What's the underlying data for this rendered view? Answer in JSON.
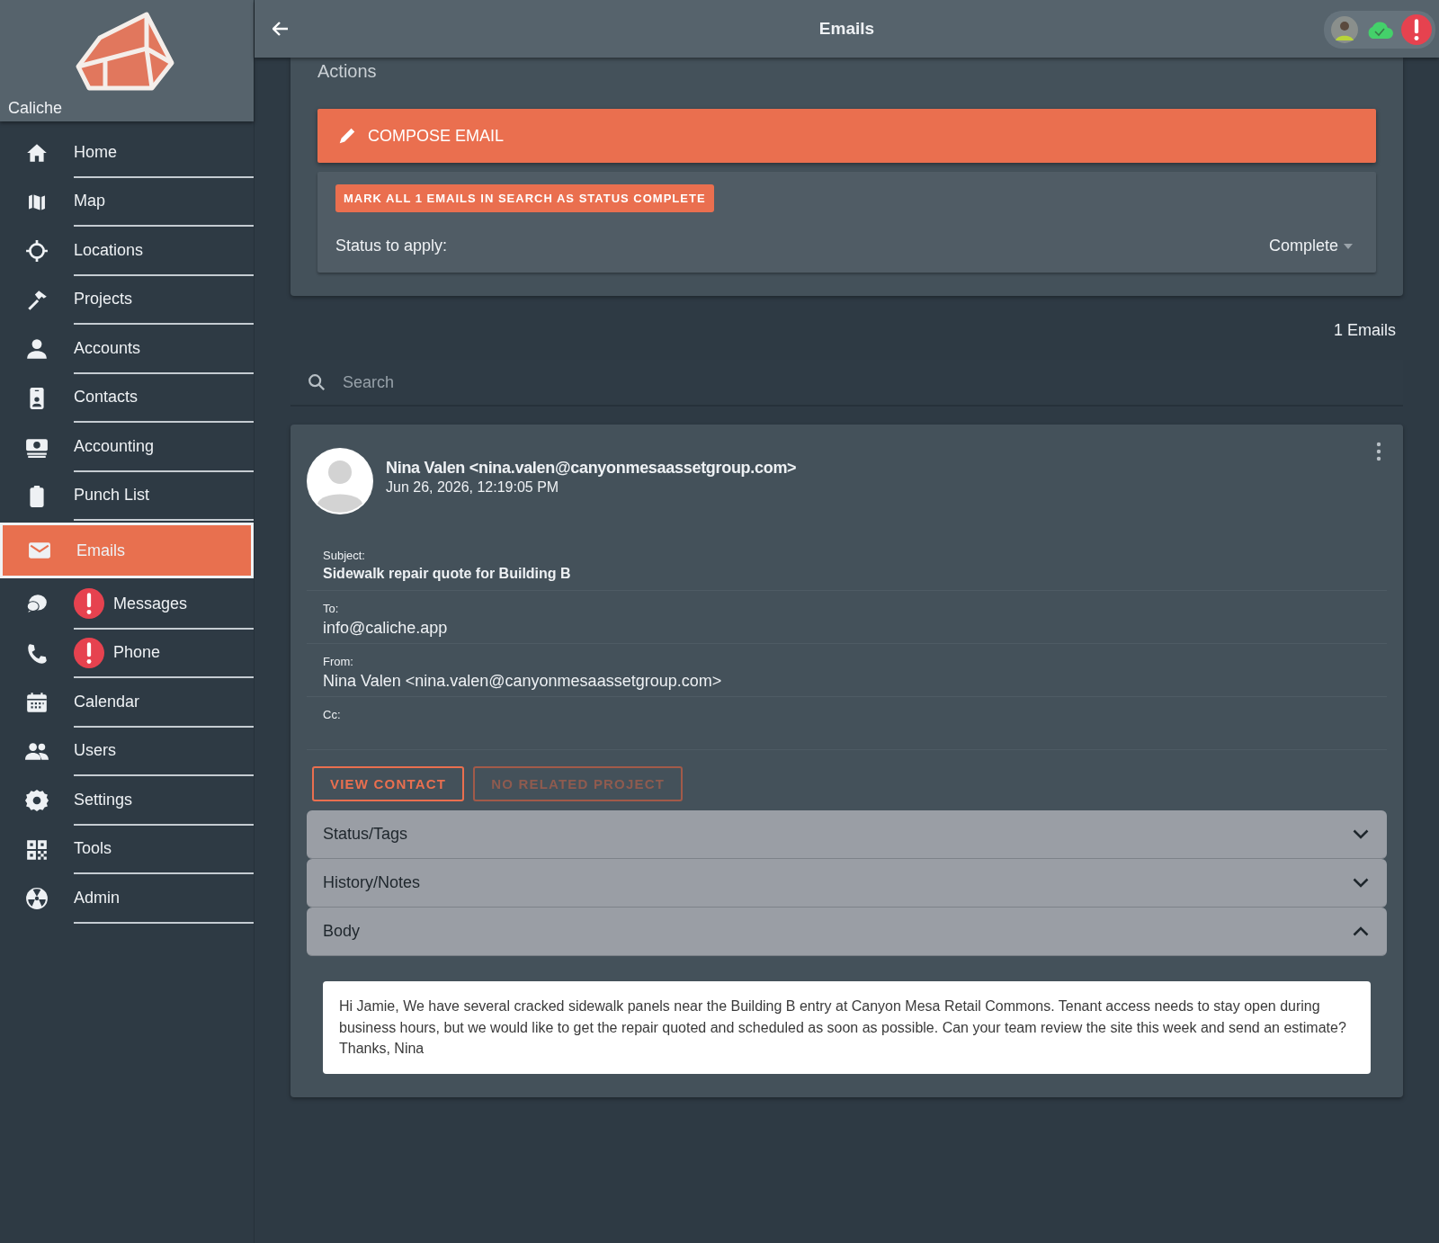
{
  "app": {
    "name": "Caliche"
  },
  "sidebar": {
    "items": [
      {
        "label": "Home",
        "kind": "home",
        "selected": false,
        "alert": false
      },
      {
        "label": "Map",
        "kind": "map",
        "selected": false,
        "alert": false
      },
      {
        "label": "Locations",
        "kind": "crosshair",
        "selected": false,
        "alert": false
      },
      {
        "label": "Projects",
        "kind": "hammer",
        "selected": false,
        "alert": false
      },
      {
        "label": "Accounts",
        "kind": "person",
        "selected": false,
        "alert": false
      },
      {
        "label": "Contacts",
        "kind": "badge",
        "selected": false,
        "alert": false
      },
      {
        "label": "Accounting",
        "kind": "money",
        "selected": false,
        "alert": false
      },
      {
        "label": "Punch List",
        "kind": "clipboard",
        "selected": false,
        "alert": false
      },
      {
        "label": "Emails",
        "kind": "mail",
        "selected": true,
        "alert": false
      },
      {
        "label": "Messages",
        "kind": "chat",
        "selected": false,
        "alert": true
      },
      {
        "label": "Phone",
        "kind": "phone",
        "selected": false,
        "alert": true
      },
      {
        "label": "Calendar",
        "kind": "calendar",
        "selected": false,
        "alert": false
      },
      {
        "label": "Users",
        "kind": "people",
        "selected": false,
        "alert": false
      },
      {
        "label": "Settings",
        "kind": "gear",
        "selected": false,
        "alert": false
      },
      {
        "label": "Tools",
        "kind": "grid",
        "selected": false,
        "alert": false
      },
      {
        "label": "Admin",
        "kind": "radiation",
        "selected": false,
        "alert": false
      }
    ]
  },
  "header": {
    "title": "Emails"
  },
  "actions": {
    "title": "Actions",
    "compose_button": "COMPOSE EMAIL",
    "mark_button": "MARK ALL 1 EMAILS IN SEARCH AS STATUS COMPLETE",
    "status_label": "Status to apply:",
    "status_value": "Complete"
  },
  "count": "1 Emails",
  "search": {
    "placeholder": "Search"
  },
  "email": {
    "sender": "Nina Valen <nina.valen@canyonmesaassetgroup.com>",
    "date": "Jun 26, 2026, 12:19:05 PM",
    "fields": [
      {
        "label": "Subject:",
        "value": "Sidewalk repair quote for Building B"
      },
      {
        "label": "To:",
        "value": "info@caliche.app"
      },
      {
        "label": "From:",
        "value": "Nina Valen <nina.valen@canyonmesaassetgroup.com>"
      },
      {
        "label": "Cc:"
      }
    ],
    "buttons": [
      {
        "label": "VIEW CONTACT",
        "disabled": false
      },
      {
        "label": "NO RELATED PROJECT",
        "disabled": true
      }
    ],
    "sections": [
      {
        "title": "Status/Tags",
        "expanded": false
      },
      {
        "title": "History/Notes",
        "expanded": false
      },
      {
        "title": "Body",
        "expanded": true
      }
    ],
    "body": "Hi Jamie, We have several cracked sidewalk panels near the Building B entry at Canyon Mesa Retail Commons. Tenant access needs to stay open during business hours, but we would like to get the repair quoted and scheduled as soon as possible. Can your team review the site this week and send an estimate? Thanks, Nina"
  }
}
